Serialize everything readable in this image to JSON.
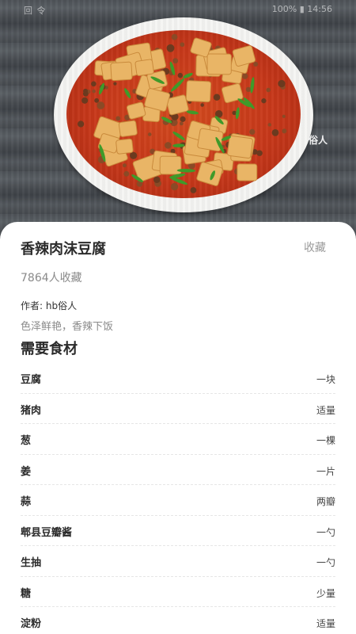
{
  "status_bar": {
    "left_text": "回 令",
    "right_text": "100% ▮ 14:56"
  },
  "hero": {
    "image_subject": "麻婆豆腐 dish photo on white plate over wooden table",
    "watermark": "俗人"
  },
  "recipe": {
    "title": "香辣肉沫豆腐",
    "collect_label": "收藏",
    "collect_count": "7864人收藏",
    "author": "作者: hb俗人",
    "description": "色泽鲜艳，香辣下饭"
  },
  "ingredients_section": {
    "title": "需要食材",
    "items": [
      {
        "name": "豆腐",
        "qty": "一块"
      },
      {
        "name": "猪肉",
        "qty": "适量"
      },
      {
        "name": "葱",
        "qty": "一棵"
      },
      {
        "name": "姜",
        "qty": "一片"
      },
      {
        "name": "蒜",
        "qty": "两瓣"
      },
      {
        "name": "郫县豆瓣酱",
        "qty": "一勺"
      },
      {
        "name": "生抽",
        "qty": "一勺"
      },
      {
        "name": "糖",
        "qty": "少量"
      },
      {
        "name": "淀粉",
        "qty": "适量"
      }
    ]
  },
  "colors": {
    "sheet_bg": "#ffffff",
    "title_text": "#2b2b2b",
    "muted_text": "#8a8a8a",
    "sauce_red": "#c7381a",
    "tofu_yellow": "#e9b566",
    "scallion_green": "#3f9a2a"
  }
}
